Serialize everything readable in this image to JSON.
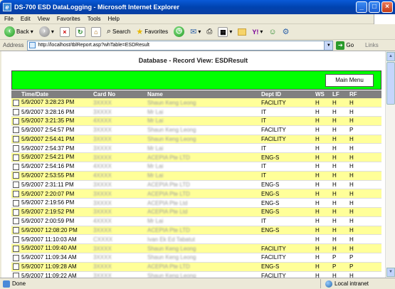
{
  "window": {
    "title": "DS-700 ESD DataLogging - Microsoft Internet Explorer"
  },
  "menu": [
    "File",
    "Edit",
    "View",
    "Favorites",
    "Tools",
    "Help"
  ],
  "toolbar": {
    "back": "Back",
    "search": "Search",
    "favorites": "Favorites"
  },
  "address": {
    "label": "Address",
    "url": "http://localhost/tblReport.asp?whTable=ESDResult",
    "go": "Go",
    "links": "Links"
  },
  "page": {
    "heading": "Database - Record View: ESDResult",
    "main_menu": "Main Menu"
  },
  "table": {
    "headers": [
      "Time/Date",
      "Card No",
      "Name",
      "Dept ID",
      "WS",
      "LF",
      "RF"
    ],
    "rows": [
      {
        "time": "5/9/2007 3:28:23 PM",
        "card": "3XXXX",
        "name": "Shaun Keng Leong",
        "dept": "FACILITY",
        "ws": "H",
        "lf": "H",
        "rf": "H"
      },
      {
        "time": "5/9/2007 3:28:16 PM",
        "card": "3XXXX",
        "name": "Mr Lai",
        "dept": "IT",
        "ws": "H",
        "lf": "H",
        "rf": "H"
      },
      {
        "time": "5/9/2007 3:21:35 PM",
        "card": "4XXXX",
        "name": "Mr Lai",
        "dept": "IT",
        "ws": "H",
        "lf": "H",
        "rf": "H"
      },
      {
        "time": "5/9/2007 2:54:57 PM",
        "card": "3XXXX",
        "name": "Shaun Keng Leong",
        "dept": "FACILITY",
        "ws": "H",
        "lf": "H",
        "rf": "P"
      },
      {
        "time": "5/9/2007 2:54:41 PM",
        "card": "3XXXX",
        "name": "Shaun Keng Leong",
        "dept": "FACILITY",
        "ws": "H",
        "lf": "H",
        "rf": "H"
      },
      {
        "time": "5/9/2007 2:54:37 PM",
        "card": "3XXXX",
        "name": "Mr Lai",
        "dept": "IT",
        "ws": "H",
        "lf": "H",
        "rf": "H"
      },
      {
        "time": "5/9/2007 2:54:21 PM",
        "card": "3XXXX",
        "name": "ACEPIA Pte LTD",
        "dept": "ENG-S",
        "ws": "H",
        "lf": "H",
        "rf": "H"
      },
      {
        "time": "5/9/2007 2:54:16 PM",
        "card": "4XXXX",
        "name": "Mr Lai",
        "dept": "IT",
        "ws": "H",
        "lf": "H",
        "rf": "H"
      },
      {
        "time": "5/9/2007 2:53:55 PM",
        "card": "4XXXX",
        "name": "Mr Lai",
        "dept": "IT",
        "ws": "H",
        "lf": "H",
        "rf": "H"
      },
      {
        "time": "5/9/2007 2:31:11 PM",
        "card": "3XXXX",
        "name": "ACEPIA Pte LTD",
        "dept": "ENG-S",
        "ws": "H",
        "lf": "H",
        "rf": "H"
      },
      {
        "time": "5/9/2007 2:20:07 PM",
        "card": "3XXXX",
        "name": "ACEPIA Pte LTD",
        "dept": "ENG-S",
        "ws": "H",
        "lf": "H",
        "rf": "H"
      },
      {
        "time": "5/9/2007 2:19:56 PM",
        "card": "3XXXX",
        "name": "ACEPIA Pte Ltd",
        "dept": "ENG-S",
        "ws": "H",
        "lf": "H",
        "rf": "H"
      },
      {
        "time": "5/9/2007 2:19:52 PM",
        "card": "3XXXX",
        "name": "ACEPIA Pte Ltd",
        "dept": "ENG-S",
        "ws": "H",
        "lf": "H",
        "rf": "H"
      },
      {
        "time": "5/9/2007 2:00:59 PM",
        "card": "4XXXX",
        "name": "Mr Lai",
        "dept": "IT",
        "ws": "H",
        "lf": "H",
        "rf": "H"
      },
      {
        "time": "5/9/2007 12:08:20 PM",
        "card": "3XXXX",
        "name": "ACEPIA Pte LTD",
        "dept": "ENG-S",
        "ws": "H",
        "lf": "H",
        "rf": "H"
      },
      {
        "time": "5/9/2007 11:10:03 AM",
        "card": "CXXXX",
        "name": "Ivan Ek Ed Tabatut",
        "dept": "",
        "ws": "H",
        "lf": "H",
        "rf": "H"
      },
      {
        "time": "5/9/2007 11:09:40 AM",
        "card": "3XXXX",
        "name": "Shaun Keng Leong",
        "dept": "FACILITY",
        "ws": "H",
        "lf": "H",
        "rf": "H"
      },
      {
        "time": "5/9/2007 11:09:34 AM",
        "card": "3XXXX",
        "name": "Shaun Keng Leong",
        "dept": "FACILITY",
        "ws": "H",
        "lf": "P",
        "rf": "P"
      },
      {
        "time": "5/9/2007 11:09:28 AM",
        "card": "3XXXX",
        "name": "ACEPIA Pte LTD",
        "dept": "ENG-S",
        "ws": "H",
        "lf": "P",
        "rf": "P"
      },
      {
        "time": "5/9/2007 11:09:22 AM",
        "card": "3XXXX",
        "name": "Shaun Keng Leong",
        "dept": "FACILITY",
        "ws": "H",
        "lf": "H",
        "rf": "H"
      }
    ]
  },
  "status": {
    "left": "Done",
    "zone": "Local intranet"
  }
}
